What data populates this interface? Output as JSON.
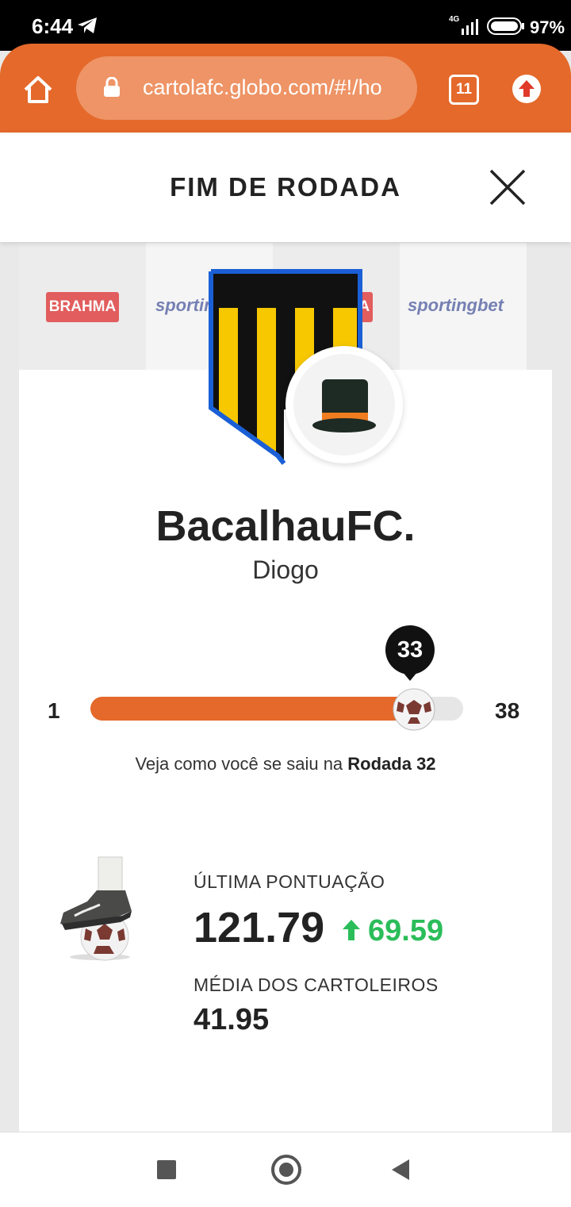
{
  "status_bar": {
    "time": "6:44",
    "network": "4G",
    "battery": "97%"
  },
  "browser": {
    "url": "cartolafc.globo.com/#!/ho",
    "tab_count": "11"
  },
  "modal": {
    "title": "FIM DE RODADA"
  },
  "sponsors": [
    "BRAHMA",
    "sportingbet",
    "BRAHMA",
    "sportingbet"
  ],
  "team": {
    "name": "BacalhauFC.",
    "owner": "Diogo"
  },
  "progress": {
    "min": "1",
    "max": "38",
    "current": "33",
    "fraction": 0.865
  },
  "round_note": {
    "prefix": "Veja como você se saiu na ",
    "round": "Rodada 32"
  },
  "stats": {
    "last_score_label": "ÚLTIMA PONTUAÇÃO",
    "last_score": "121.79",
    "delta": "69.59",
    "average_label": "MÉDIA DOS CARTOLEIROS",
    "average": "41.95"
  },
  "colors": {
    "accent": "#e4692b",
    "positive": "#2bbd5a"
  },
  "icons": [
    "telegram-icon",
    "home-icon",
    "lock-icon",
    "tabs-icon",
    "update-icon",
    "close-icon",
    "top-hat-icon",
    "soccer-ball-icon",
    "boot-icon",
    "arrow-up-icon"
  ]
}
